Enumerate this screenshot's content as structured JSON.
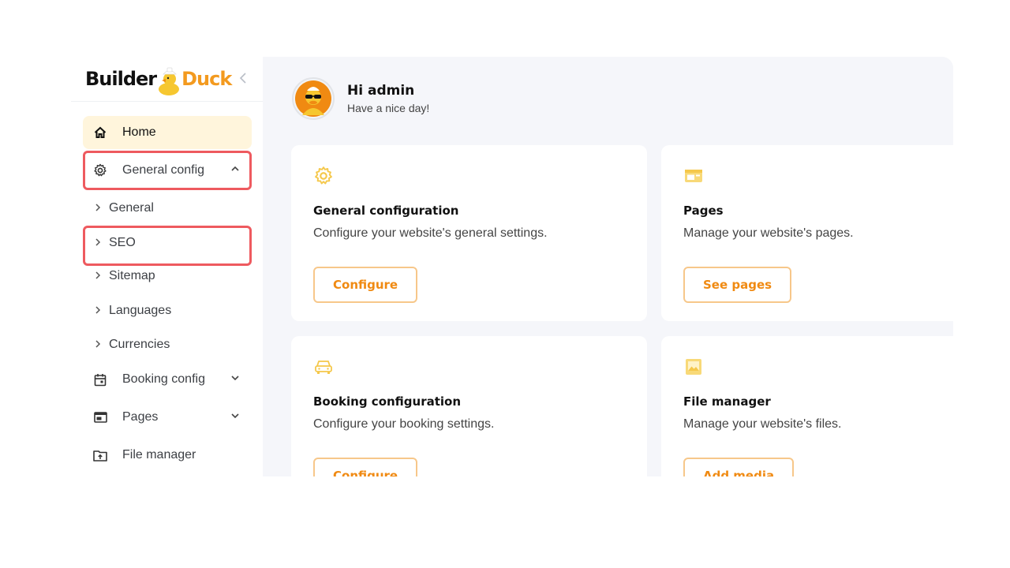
{
  "brand": {
    "part1": "Builder",
    "part2": "Duck"
  },
  "sidebar": {
    "items": [
      {
        "label": "Home"
      },
      {
        "label": "General config"
      },
      {
        "label": "Booking config"
      },
      {
        "label": "Pages"
      },
      {
        "label": "File manager"
      }
    ],
    "subitems": [
      {
        "label": "General"
      },
      {
        "label": "SEO"
      },
      {
        "label": "Sitemap"
      },
      {
        "label": "Languages"
      },
      {
        "label": "Currencies"
      }
    ]
  },
  "header": {
    "greeting": "Hi admin",
    "subtitle": "Have a nice day!"
  },
  "cards": [
    {
      "title": "General configuration",
      "description": "Configure your website's general settings.",
      "button": "Configure",
      "icon": "gear-icon"
    },
    {
      "title": "Pages",
      "description": "Manage your website's pages.",
      "button": "See pages",
      "icon": "layout-icon"
    },
    {
      "title": "Booking configuration",
      "description": "Configure your booking settings.",
      "button": "Configure",
      "icon": "car-icon"
    },
    {
      "title": "File manager",
      "description": "Manage your website's files.",
      "button": "Add media",
      "icon": "image-icon"
    }
  ],
  "colors": {
    "accent": "#f39a1f",
    "highlight": "#ee5a5f",
    "active_bg": "#fff5dc",
    "icon_yellow": "#f5c84b"
  }
}
